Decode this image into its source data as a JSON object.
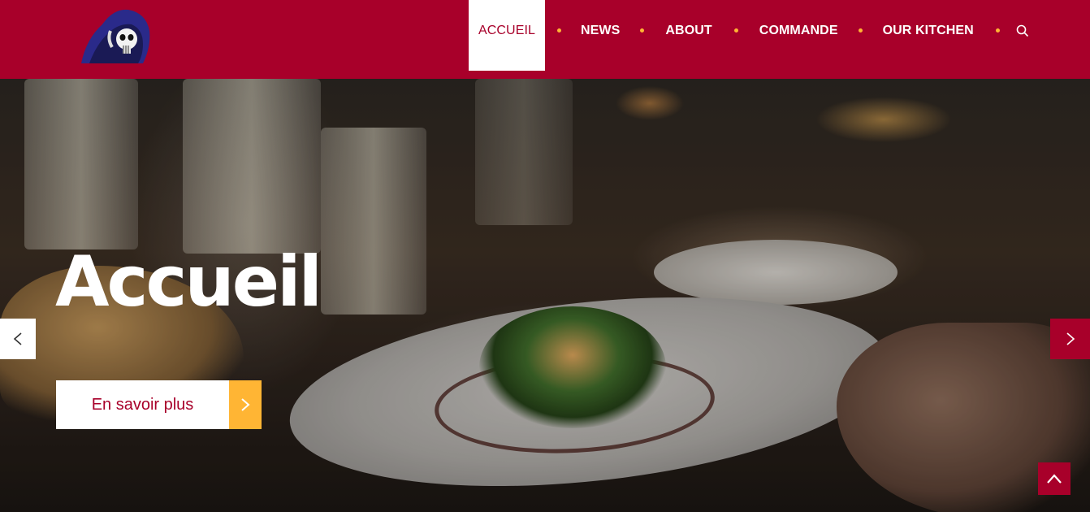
{
  "brand": {
    "logo_icon": "hooded-skull-logo",
    "accent": "#a8002a",
    "highlight": "#ffb534"
  },
  "nav": {
    "items": [
      {
        "label": "ACCUEIL",
        "active": true
      },
      {
        "label": "NEWS"
      },
      {
        "label": "ABOUT"
      },
      {
        "label": "COMMANDE"
      },
      {
        "label": "OUR KITCHEN"
      }
    ],
    "search_icon": "search-icon"
  },
  "hero": {
    "title": "Accueil",
    "cta_label": "En savoir plus",
    "cta_icon": "chevron-right-icon",
    "prev_icon": "chevron-left-icon",
    "next_icon": "chevron-right-icon"
  },
  "back_to_top": {
    "icon": "chevron-up-icon"
  }
}
